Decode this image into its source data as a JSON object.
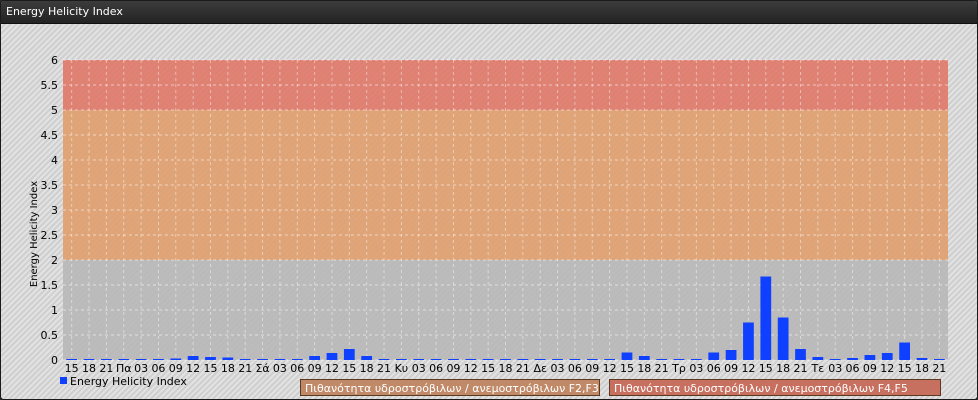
{
  "window": {
    "title": "Energy Helicity Index"
  },
  "legend": {
    "series_label": "Energy Helicity Index",
    "band_1_label": "Πιθανότητα υδροστρόβιλων / ανεμοστρόβιλων F2,F3",
    "band_2_label": "Πιθανότητα υδροστρόβιλων / ανεμοστρόβιλων F4,F5"
  },
  "colors": {
    "bar": "#1040ff",
    "band_low": "#b8b8b8",
    "band_mid": "#e0a070",
    "band_high": "#e07a6a",
    "band_1_legend": "#c08a68",
    "band_2_legend": "#c87060"
  },
  "chart_data": {
    "type": "bar",
    "ylabel": "Energy Helicity Index",
    "xlabel": "",
    "ylim": [
      0,
      6
    ],
    "yticks": [
      "0",
      "0.5",
      "1",
      "1.5",
      "2",
      "2.5",
      "3",
      "3.5",
      "4",
      "4.5",
      "5",
      "5.5",
      "6"
    ],
    "bands": [
      {
        "from": 0,
        "to": 2
      },
      {
        "from": 2,
        "to": 5
      },
      {
        "from": 5,
        "to": 6
      }
    ],
    "grid": true,
    "categories": [
      "15",
      "18",
      "21",
      "Πα",
      "03",
      "06",
      "09",
      "12",
      "15",
      "18",
      "21",
      "Σά",
      "03",
      "06",
      "09",
      "12",
      "15",
      "18",
      "21",
      "Κυ",
      "03",
      "06",
      "09",
      "12",
      "15",
      "18",
      "21",
      "Δε",
      "03",
      "06",
      "09",
      "12",
      "15",
      "18",
      "21",
      "Τρ",
      "03",
      "06",
      "09",
      "12",
      "15",
      "18",
      "21",
      "Τε",
      "03",
      "06",
      "09",
      "12",
      "15",
      "18",
      "21"
    ],
    "series": [
      {
        "name": "Energy Helicity Index",
        "values": [
          0.02,
          0.02,
          0.02,
          0.02,
          0.02,
          0.02,
          0.03,
          0.08,
          0.06,
          0.05,
          0.02,
          0.02,
          0.02,
          0.02,
          0.08,
          0.14,
          0.22,
          0.08,
          0.02,
          0.02,
          0.02,
          0.02,
          0.02,
          0.02,
          0.02,
          0.02,
          0.02,
          0.02,
          0.02,
          0.02,
          0.02,
          0.02,
          0.15,
          0.08,
          0.02,
          0.02,
          0.02,
          0.15,
          0.2,
          0.75,
          1.67,
          0.85,
          0.22,
          0.06,
          0.02,
          0.04,
          0.1,
          0.14,
          0.35,
          0.04,
          0.02
        ]
      }
    ]
  }
}
